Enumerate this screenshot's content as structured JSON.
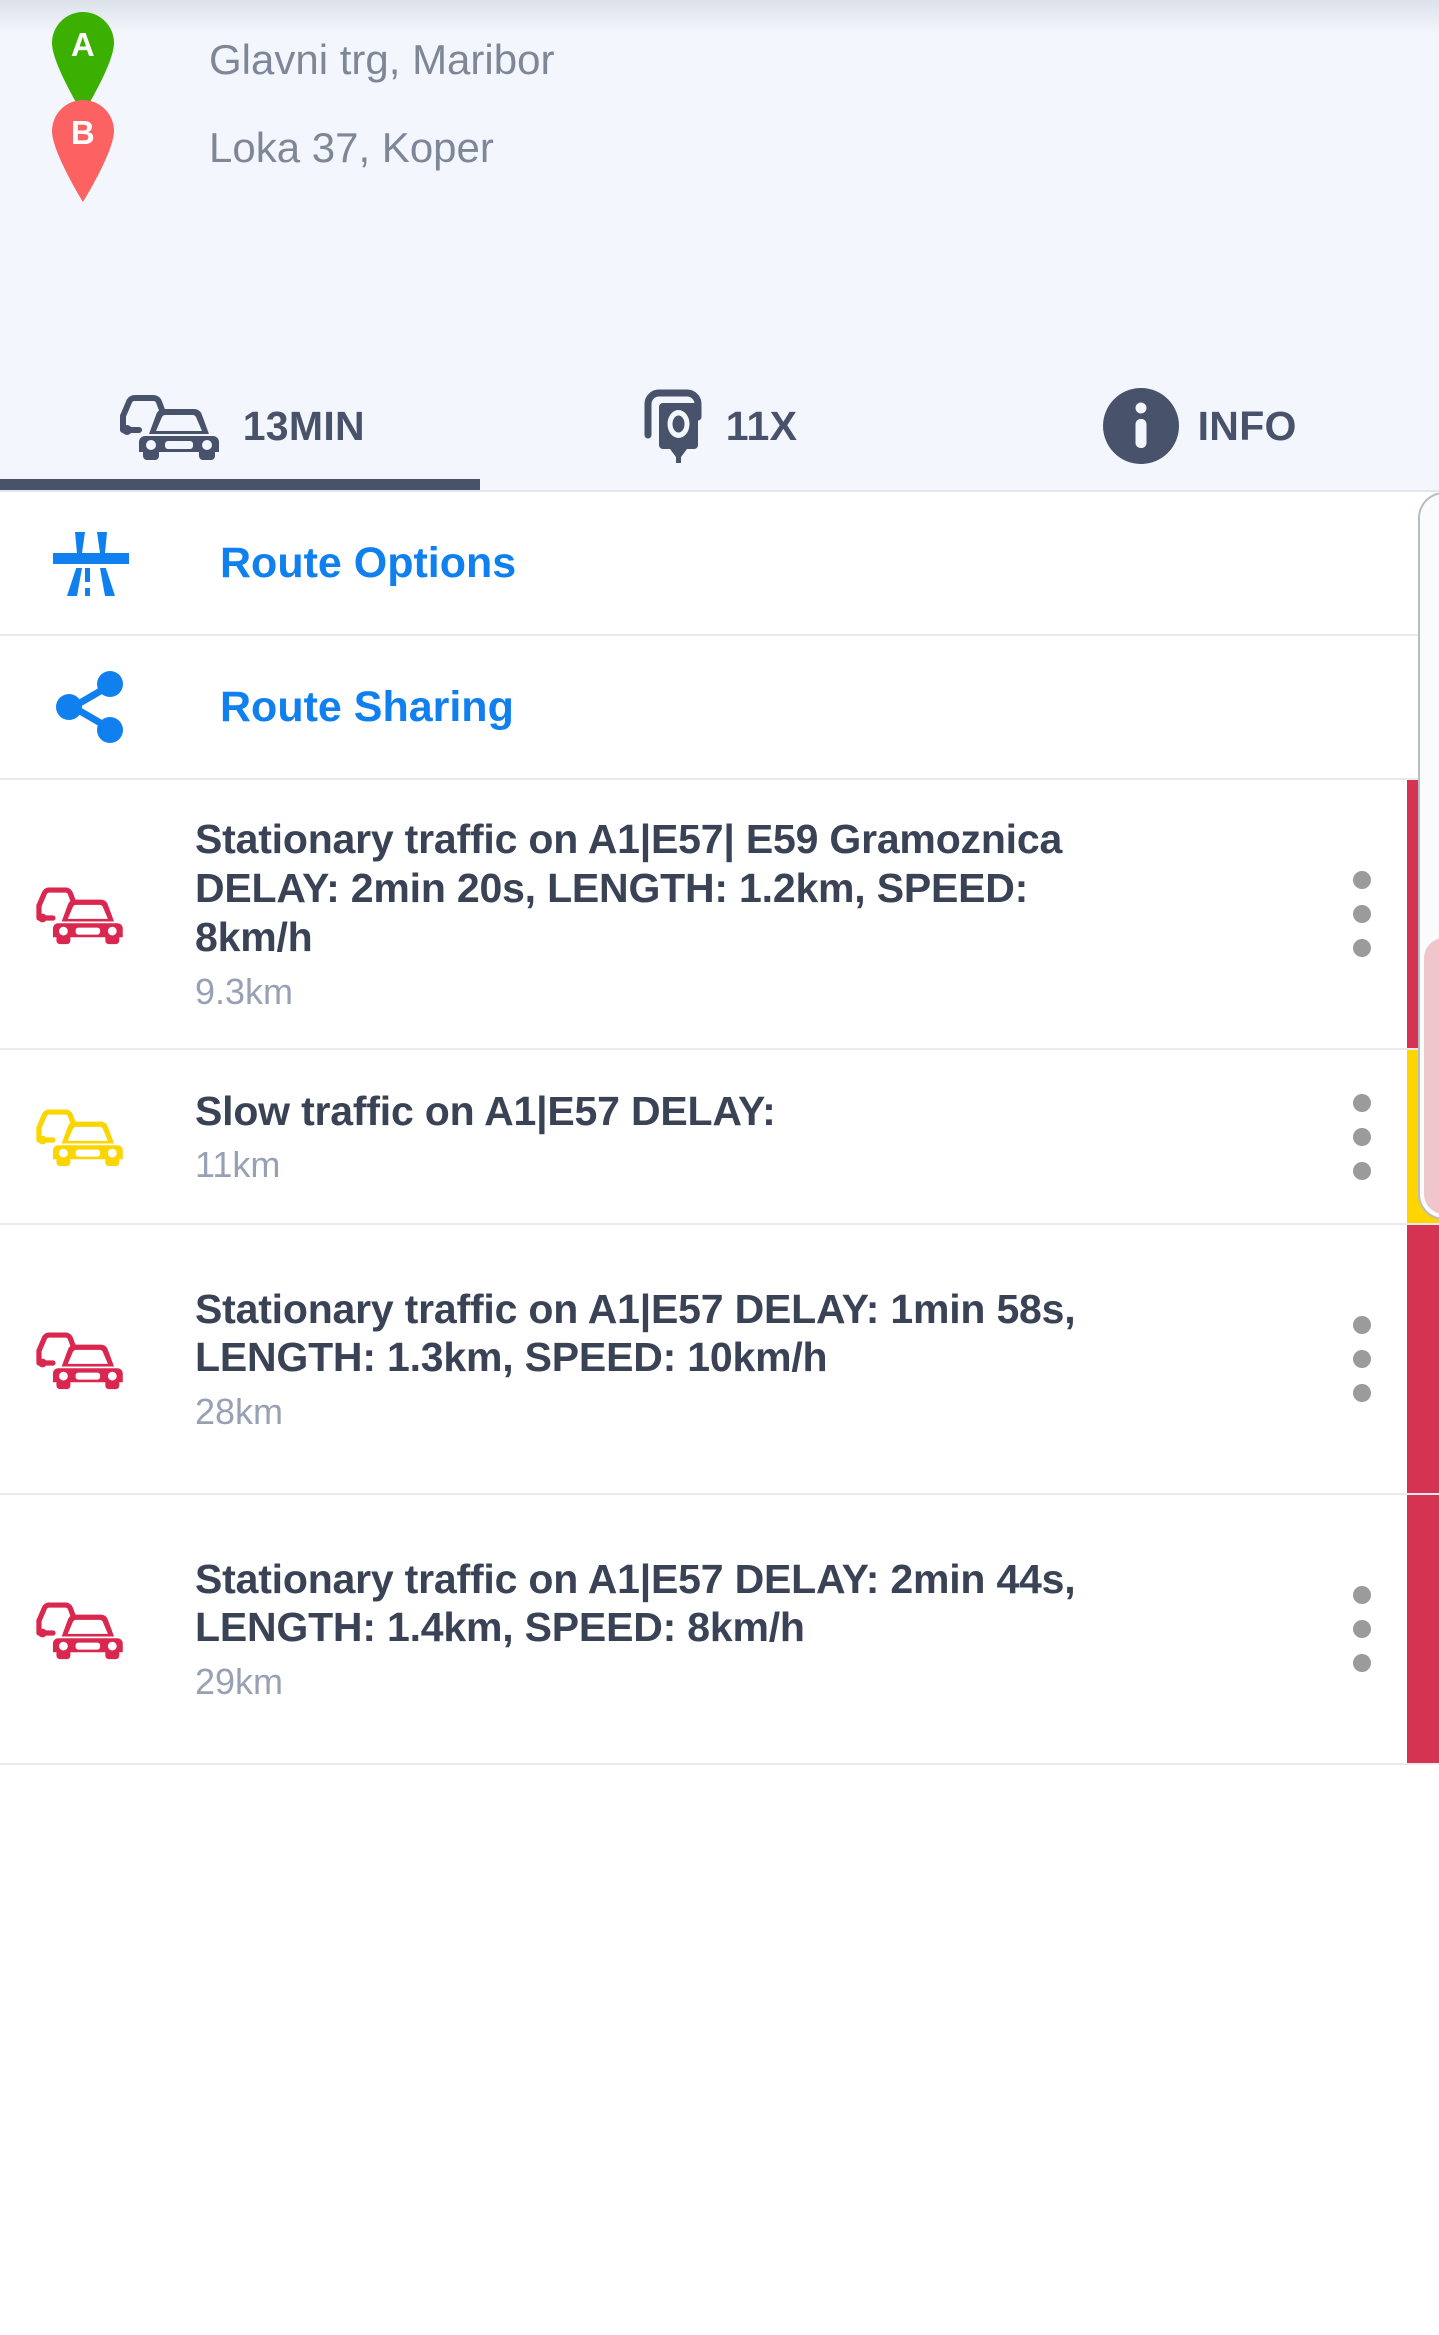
{
  "header": {
    "origin": {
      "marker": "A",
      "marker_color": "#3cb000",
      "address": "Glavni trg, Maribor"
    },
    "destination": {
      "marker": "B",
      "marker_color": "#fc6262",
      "address": "Loka 37, Koper"
    }
  },
  "tabs": [
    {
      "id": "traffic",
      "icon": "traffic-cars-icon",
      "label": "13MIN",
      "active": true
    },
    {
      "id": "cameras",
      "icon": "speed-camera-icon",
      "label": "11X",
      "active": false
    },
    {
      "id": "info",
      "icon": "info-circle-icon",
      "label": "INFO",
      "active": false
    }
  ],
  "menu_items": [
    {
      "id": "route-options",
      "icon": "motorway-icon",
      "label": "Route Options",
      "color": "#1180ef"
    },
    {
      "id": "route-sharing",
      "icon": "share-icon",
      "label": "Route Sharing",
      "color": "#1180ef"
    }
  ],
  "incidents": [
    {
      "severity": "stationary",
      "icon": "traffic-cars-icon",
      "icon_color": "#d9274f",
      "bar_color": "#d63352",
      "title": "Stationary traffic on A1|E57| E59 Gramoznica DELAY: 2min 20s, LENGTH: 1.2km, SPEED: 8km/h",
      "distance": "9.3km",
      "menu": "three-dots"
    },
    {
      "severity": "slow",
      "icon": "traffic-cars-icon",
      "icon_color": "#fbd500",
      "bar_color": "#ffd500",
      "title": "Slow traffic on A1|E57 DELAY:",
      "distance": "11km",
      "menu": "three-dots"
    },
    {
      "severity": "stationary",
      "icon": "traffic-cars-icon",
      "icon_color": "#d9274f",
      "bar_color": "#d63352",
      "title": "Stationary traffic on A1|E57 DELAY: 1min 58s, LENGTH: 1.3km, SPEED: 10km/h",
      "distance": "28km",
      "menu": "three-dots"
    },
    {
      "severity": "stationary",
      "icon": "traffic-cars-icon",
      "icon_color": "#d9274f",
      "bar_color": "#d63352",
      "title": "Stationary traffic on A1|E57 DELAY: 2min 44s, LENGTH: 1.4km, SPEED: 8km/h",
      "distance": "29km",
      "menu": "three-dots"
    }
  ],
  "colors": {
    "header_bg": "#f3f6fc",
    "accent_blue": "#1180ef",
    "tab_dark": "#48526a",
    "text_muted": "#7e8798",
    "red": "#d63352",
    "yellow": "#ffd500",
    "green": "#3cb000"
  }
}
